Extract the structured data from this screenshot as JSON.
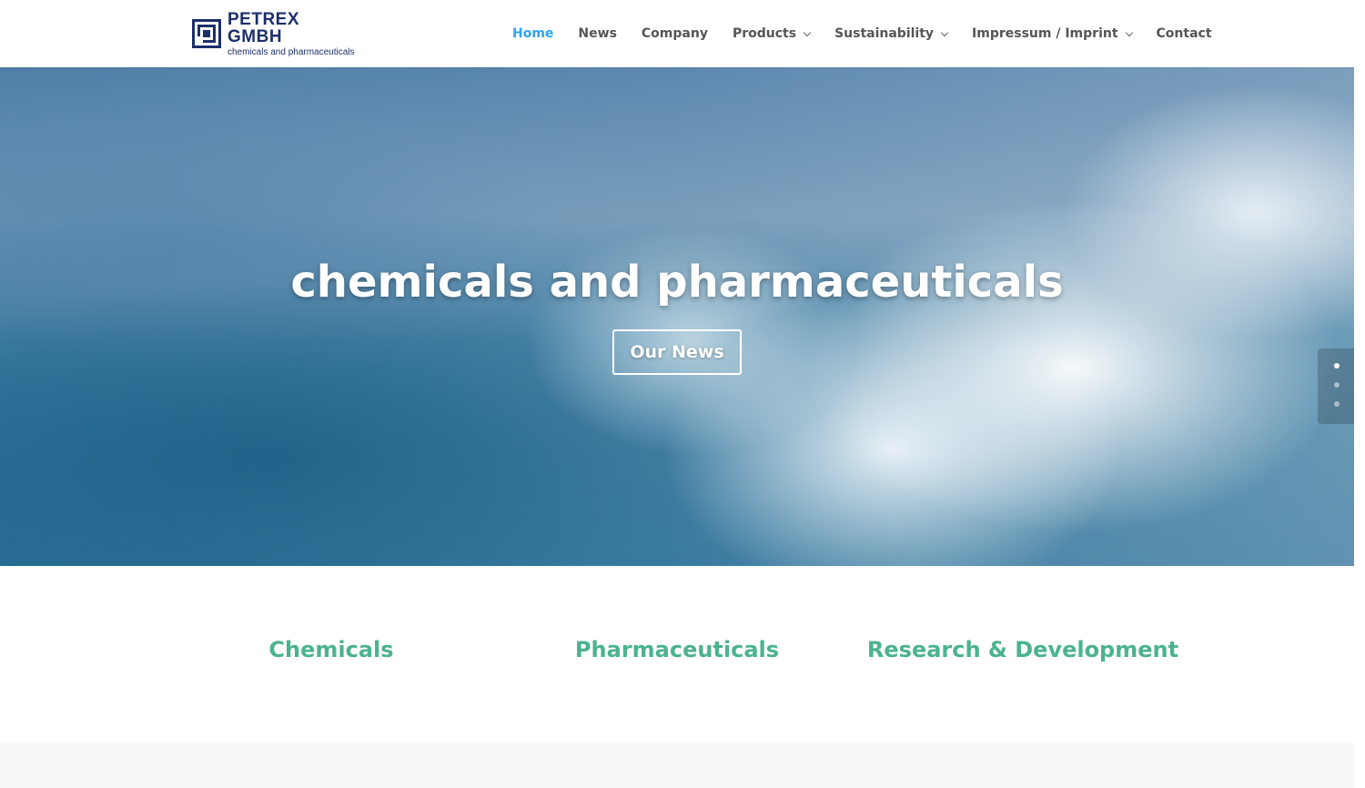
{
  "brand": {
    "name": "PETREX GMBH",
    "tagline": "chemicals and pharmaceuticals",
    "color": "#1c2f6b"
  },
  "nav": {
    "items": [
      {
        "label": "Home",
        "active": true,
        "has_dropdown": false
      },
      {
        "label": "News",
        "active": false,
        "has_dropdown": false
      },
      {
        "label": "Company",
        "active": false,
        "has_dropdown": false
      },
      {
        "label": "Products",
        "active": false,
        "has_dropdown": true
      },
      {
        "label": "Sustainability",
        "active": false,
        "has_dropdown": true
      },
      {
        "label": "Impressum / Imprint",
        "active": false,
        "has_dropdown": true
      },
      {
        "label": "Contact",
        "active": false,
        "has_dropdown": false
      }
    ],
    "active_color": "#2ea3f2"
  },
  "hero": {
    "title": "chemicals and pharmaceuticals",
    "button_label": "Our News",
    "slides": 3,
    "active_slide": 1
  },
  "services": {
    "items": [
      "Chemicals",
      "Pharmaceuticals",
      "Research & Development"
    ],
    "color": "#4bb38e"
  }
}
